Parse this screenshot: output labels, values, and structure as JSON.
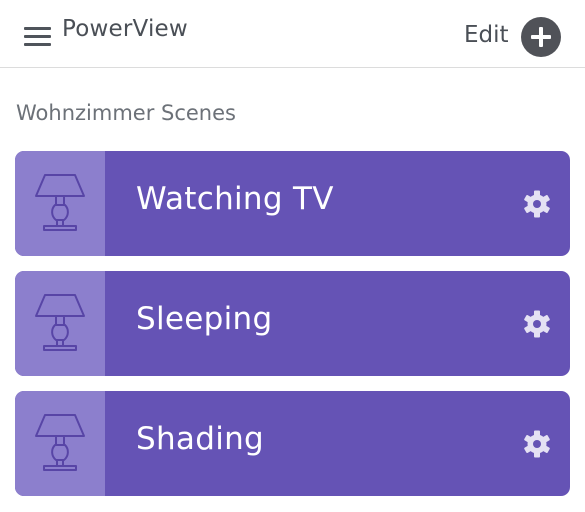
{
  "header": {
    "app_title": "PowerView",
    "edit_label": "Edit",
    "menu_icon": "hamburger-menu-icon",
    "add_icon": "plus-circle-icon"
  },
  "section_title": "Wohnzimmer Scenes",
  "scenes": [
    {
      "label": "Watching TV",
      "icon": "lamp-icon",
      "settings_icon": "gear-icon"
    },
    {
      "label": "Sleeping",
      "icon": "lamp-icon",
      "settings_icon": "gear-icon"
    },
    {
      "label": "Shading",
      "icon": "lamp-icon",
      "settings_icon": "gear-icon"
    }
  ],
  "colors": {
    "card_bg": "#6553b5",
    "icon_box_bg": "#8c7fcd",
    "header_text": "#4a4f56",
    "add_button": "#505258"
  }
}
